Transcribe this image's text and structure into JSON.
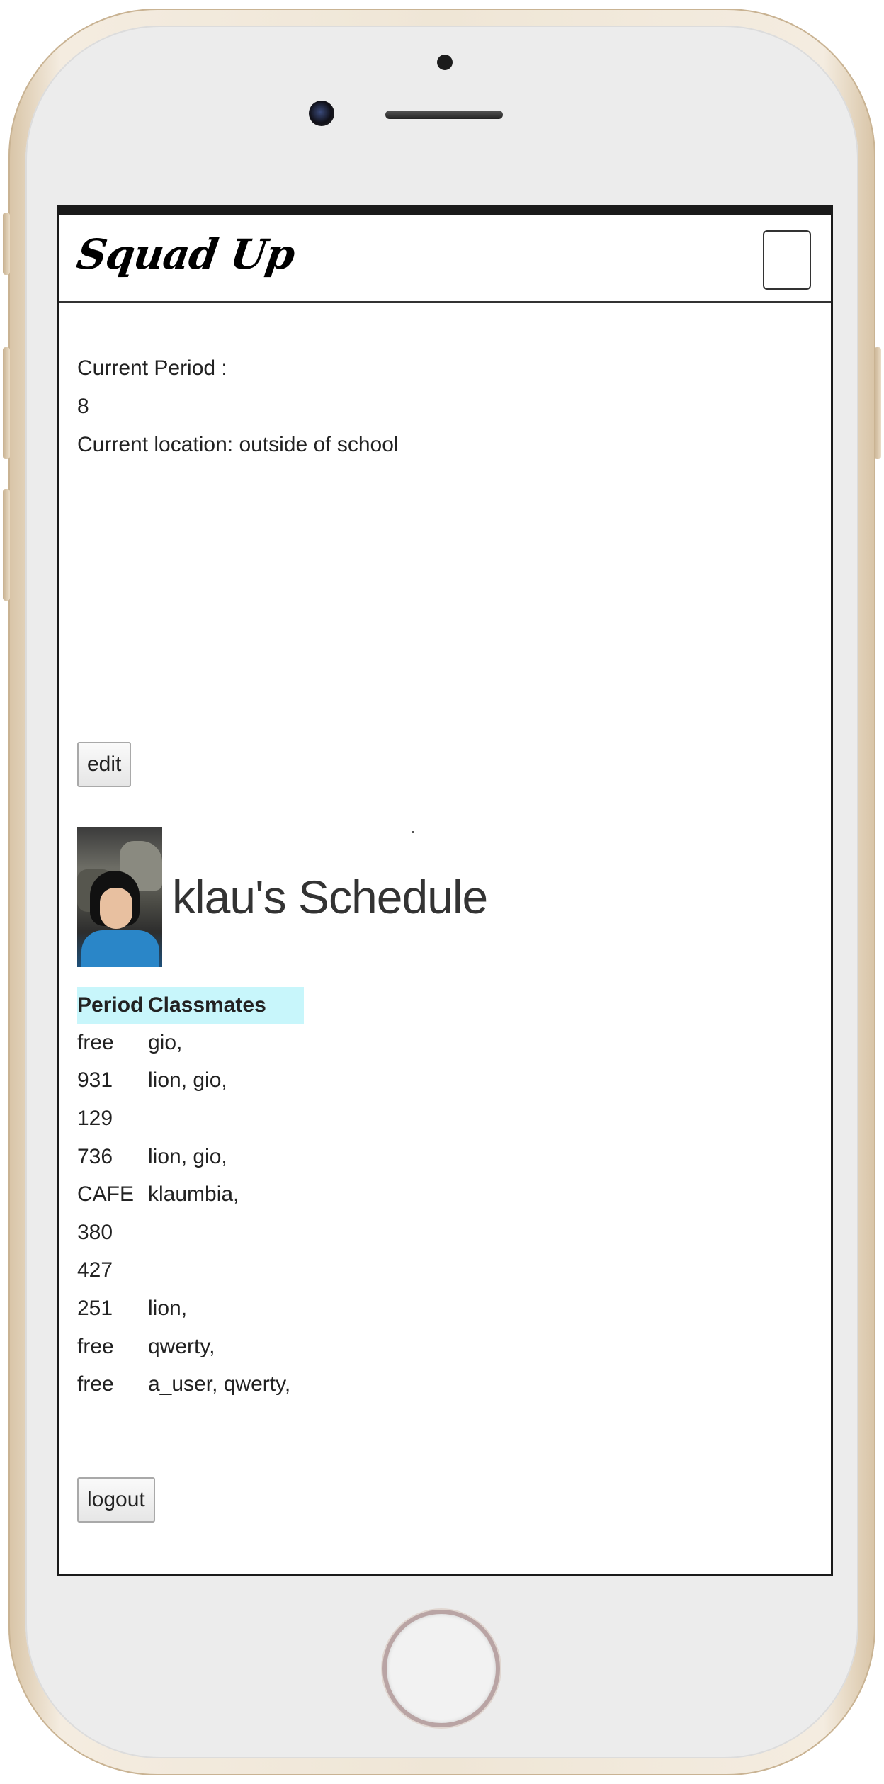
{
  "app": {
    "brand": "Squad Up"
  },
  "status": {
    "period_label": "Current Period :",
    "period_value": "8",
    "location": "Current location: outside of school"
  },
  "buttons": {
    "edit": "edit",
    "logout": "logout"
  },
  "profile": {
    "title": "klau's Schedule"
  },
  "schedule": {
    "headers": [
      "Period",
      "Classmates"
    ],
    "header_bg": "#c8f6fb",
    "rows": [
      {
        "period": "free",
        "classmates": "gio,"
      },
      {
        "period": "931",
        "classmates": "lion, gio,"
      },
      {
        "period": "129",
        "classmates": ""
      },
      {
        "period": "736",
        "classmates": "lion, gio,"
      },
      {
        "period": "CAFE",
        "classmates": "klaumbia,"
      },
      {
        "period": "380",
        "classmates": ""
      },
      {
        "period": "427",
        "classmates": ""
      },
      {
        "period": "251",
        "classmates": "lion,"
      },
      {
        "period": "free",
        "classmates": "qwerty,"
      },
      {
        "period": "free",
        "classmates": "a_user, qwerty,"
      }
    ]
  },
  "icons": {
    "menu_toggle": "menu-toggle-icon",
    "avatar": "user-avatar"
  }
}
